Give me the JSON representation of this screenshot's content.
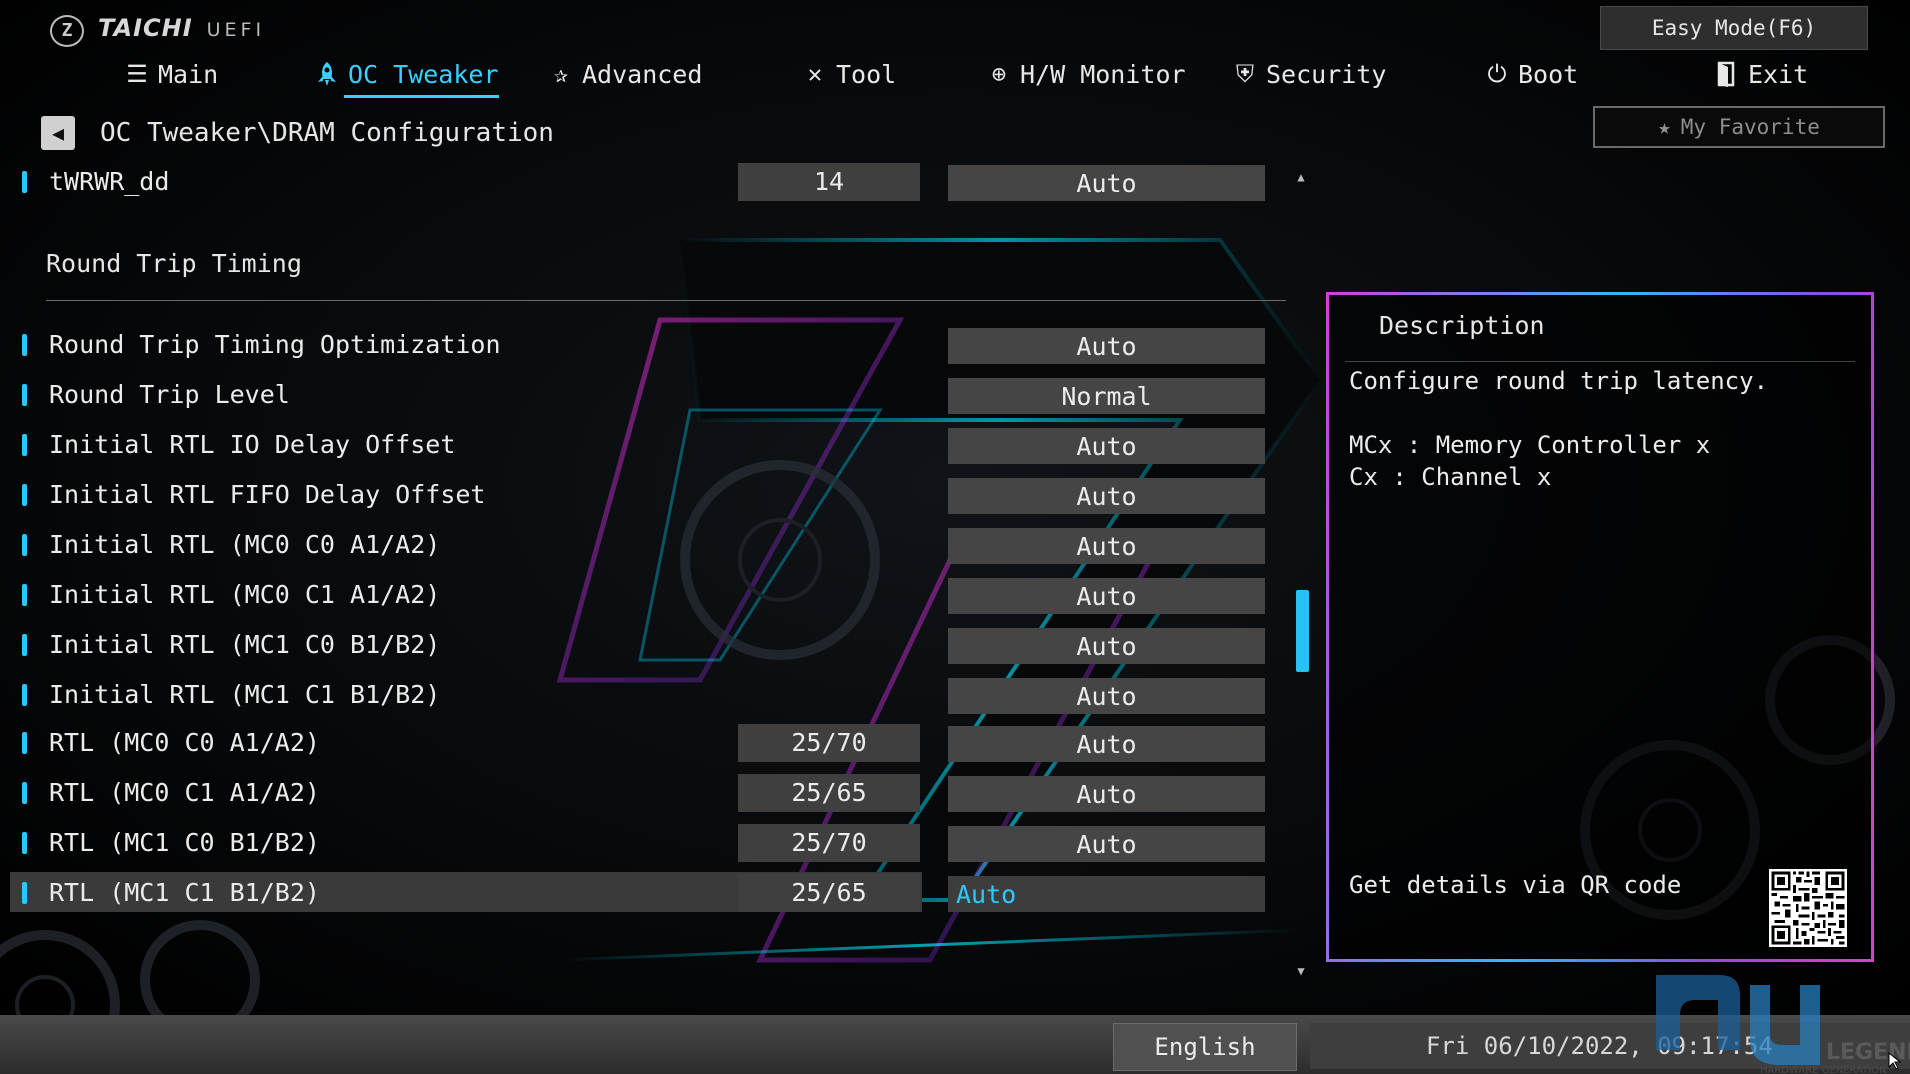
{
  "brand": {
    "name": "TAICHI",
    "sub": "UEFI"
  },
  "nav": {
    "tabs": [
      {
        "id": "main",
        "label": "Main",
        "icon": "list-icon"
      },
      {
        "id": "oc",
        "label": "OC Tweaker",
        "icon": "rocket-icon",
        "active": true
      },
      {
        "id": "adv",
        "label": "Advanced",
        "icon": "star-icon"
      },
      {
        "id": "tool",
        "label": "Tool",
        "icon": "tools-icon"
      },
      {
        "id": "hw",
        "label": "H/W Monitor",
        "icon": "crosshair-icon"
      },
      {
        "id": "sec",
        "label": "Security",
        "icon": "shield-icon"
      },
      {
        "id": "boot",
        "label": "Boot",
        "icon": "power-icon"
      },
      {
        "id": "exit",
        "label": "Exit",
        "icon": "exit-icon"
      }
    ],
    "easy_mode": "Easy Mode(F6)",
    "my_favorite": "My Favorite"
  },
  "breadcrumb": "OC Tweaker\\DRAM Configuration",
  "top_row": {
    "label": "tWRWR_dd",
    "current": "14",
    "value": "Auto"
  },
  "section": {
    "title": "Round Trip Timing"
  },
  "rows": [
    {
      "label": "Round Trip Timing Optimization",
      "current": "",
      "value": "Auto"
    },
    {
      "label": "Round Trip Level",
      "current": "",
      "value": "Normal"
    },
    {
      "label": "Initial RTL IO Delay Offset",
      "current": "",
      "value": "Auto"
    },
    {
      "label": "Initial RTL FIFO Delay Offset",
      "current": "",
      "value": "Auto"
    },
    {
      "label": "Initial RTL (MC0 C0 A1/A2)",
      "current": "",
      "value": "Auto"
    },
    {
      "label": "Initial RTL (MC0 C1 A1/A2)",
      "current": "",
      "value": "Auto"
    },
    {
      "label": "Initial RTL (MC1 C0 B1/B2)",
      "current": "",
      "value": "Auto"
    },
    {
      "label": "Initial RTL (MC1 C1 B1/B2)",
      "current": "",
      "value": "Auto"
    },
    {
      "label": "RTL (MC0 C0 A1/A2)",
      "current": "25/70",
      "value": "Auto"
    },
    {
      "label": "RTL (MC0 C1 A1/A2)",
      "current": "25/65",
      "value": "Auto"
    },
    {
      "label": "RTL (MC1 C0 B1/B2)",
      "current": "25/70",
      "value": "Auto"
    },
    {
      "label": "RTL (MC1 C1 B1/B2)",
      "current": "25/65",
      "value": "Auto",
      "selected": true
    }
  ],
  "description": {
    "title": "Description",
    "lines": [
      "Configure round trip latency.",
      "",
      "MCx : Memory Controller x",
      "Cx : Channel x"
    ],
    "qr_text": "Get details via QR code"
  },
  "footer": {
    "language": "English",
    "datetime": "Fri 06/10/2022, 09:17:54"
  },
  "watermark": {
    "text": "LEGEND",
    "sub": "HARDWARE GENERATION"
  },
  "colors": {
    "accent": "#39d0ff",
    "panel_border": "#d040d8"
  }
}
